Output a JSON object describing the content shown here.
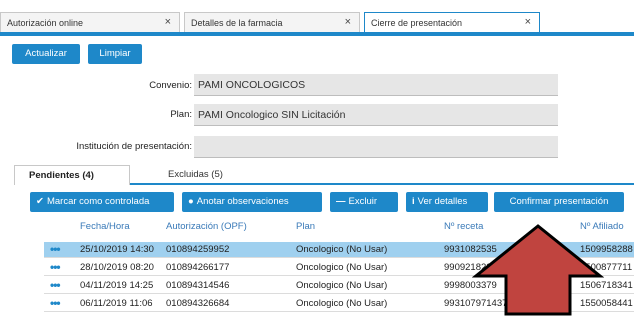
{
  "tabs": [
    {
      "label": "Autorización online",
      "close": "×"
    },
    {
      "label": "Detalles de la farmacia",
      "close": "×"
    },
    {
      "label": "Cierre de presentación",
      "close": "×"
    }
  ],
  "actions": {
    "refresh": "Actualizar",
    "clear": "Limpiar"
  },
  "form": {
    "convenio_label": "Convenio:",
    "convenio_value": "PAMI ONCOLOGICOS",
    "plan_label": "Plan:",
    "plan_value": "PAMI Oncologico SIN Licitación",
    "institucion_label": "Institución de presentación:",
    "institucion_value": ""
  },
  "subtabs": [
    {
      "label": "Pendientes (4)"
    },
    {
      "label": "Excluidas (5)"
    }
  ],
  "toolbar": {
    "mark": "Marcar como controlada",
    "notes": "Anotar observaciones",
    "exclude": "Excluir",
    "details": "Ver detalles",
    "confirm": "Confirmar presentación"
  },
  "icons": {
    "check": "check-icon",
    "comment": "comment-icon",
    "minus": "minus-icon",
    "info": "info-icon",
    "menu": "more-icon"
  },
  "colors": {
    "accent": "#1e88c9",
    "selected_row": "#9fd0ef",
    "arrow": "#c0443f"
  },
  "table": {
    "headers": [
      "Fecha/Hora",
      "Autorización (OPF)",
      "Plan",
      "Nº receta",
      "Nº Afiliado"
    ],
    "rows": [
      {
        "menu": "•••",
        "fecha": "25/10/2019 14:30",
        "autorizacion": "010894259952",
        "plan": "Oncologico (No Usar)",
        "receta": "9931082535",
        "afiliado": "1509958288"
      },
      {
        "menu": "•••",
        "fecha": "28/10/2019 08:20",
        "autorizacion": "010894266177",
        "plan": "Oncologico (No Usar)",
        "receta": "9909218220",
        "afiliado": "1500877711"
      },
      {
        "menu": "•••",
        "fecha": "04/11/2019 14:25",
        "autorizacion": "010894314546",
        "plan": "Oncologico (No Usar)",
        "receta": "9998003379",
        "afiliado": "1506718341"
      },
      {
        "menu": "•••",
        "fecha": "06/11/2019 11:06",
        "autorizacion": "010894326684",
        "plan": "Oncologico (No Usar)",
        "receta": "9931079714370",
        "afiliado": "1550058441"
      }
    ]
  }
}
